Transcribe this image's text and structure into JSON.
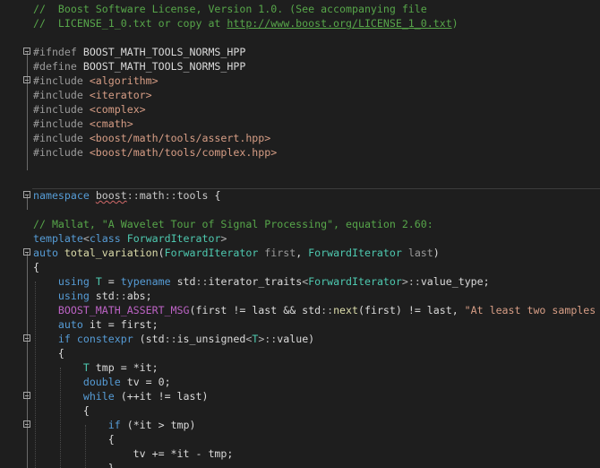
{
  "editor": {
    "lines": [
      [
        {
          "c": "comment",
          "t": "//  Boost Software License, Version 1.0. (See accompanying file"
        }
      ],
      [
        {
          "c": "comment",
          "t": "//  LICENSE_1_0.txt or copy at "
        },
        {
          "c": "link",
          "t": "http://www.boost.org/LICENSE_1_0.txt"
        },
        {
          "c": "comment",
          "t": ")"
        }
      ],
      [],
      [
        {
          "c": "pp",
          "t": "#ifndef "
        },
        {
          "c": "id",
          "t": "BOOST_MATH_TOOLS_NORMS_HPP"
        }
      ],
      [
        {
          "c": "pp",
          "t": "#define "
        },
        {
          "c": "id",
          "t": "BOOST_MATH_TOOLS_NORMS_HPP"
        }
      ],
      [
        {
          "c": "pp",
          "t": "#include "
        },
        {
          "c": "str",
          "t": "<algorithm>"
        }
      ],
      [
        {
          "c": "pp",
          "t": "#include "
        },
        {
          "c": "str",
          "t": "<iterator>"
        }
      ],
      [
        {
          "c": "pp",
          "t": "#include "
        },
        {
          "c": "str",
          "t": "<complex>"
        }
      ],
      [
        {
          "c": "pp",
          "t": "#include "
        },
        {
          "c": "str",
          "t": "<cmath>"
        }
      ],
      [
        {
          "c": "pp",
          "t": "#include "
        },
        {
          "c": "str",
          "t": "<boost/math/tools/assert.hpp>"
        }
      ],
      [
        {
          "c": "pp",
          "t": "#include "
        },
        {
          "c": "str",
          "t": "<boost/math/tools/complex.hpp>"
        }
      ],
      [],
      [],
      [
        {
          "c": "kw",
          "t": "namespace"
        },
        {
          "c": "id",
          "t": " "
        },
        {
          "c": "ns",
          "t": "boost",
          "sq": true
        },
        {
          "c": "op",
          "t": "::"
        },
        {
          "c": "ns",
          "t": "math"
        },
        {
          "c": "op",
          "t": "::"
        },
        {
          "c": "ns",
          "t": "tools"
        },
        {
          "c": "id",
          "t": " {"
        }
      ],
      [],
      [
        {
          "c": "comment",
          "t": "// Mallat, \"A Wavelet Tour of Signal Processing\", equation 2.60:"
        }
      ],
      [
        {
          "c": "kw",
          "t": "template"
        },
        {
          "c": "op",
          "t": "<"
        },
        {
          "c": "kw",
          "t": "class"
        },
        {
          "c": "id",
          "t": " "
        },
        {
          "c": "type",
          "t": "ForwardIterator"
        },
        {
          "c": "op",
          "t": ">"
        }
      ],
      [
        {
          "c": "kw",
          "t": "auto"
        },
        {
          "c": "id",
          "t": " "
        },
        {
          "c": "fn",
          "t": "total_variation"
        },
        {
          "c": "id",
          "t": "("
        },
        {
          "c": "type",
          "t": "ForwardIterator"
        },
        {
          "c": "id",
          "t": " "
        },
        {
          "c": "param",
          "t": "first"
        },
        {
          "c": "id",
          "t": ", "
        },
        {
          "c": "type",
          "t": "ForwardIterator"
        },
        {
          "c": "id",
          "t": " "
        },
        {
          "c": "param",
          "t": "last"
        },
        {
          "c": "id",
          "t": ")"
        }
      ],
      [
        {
          "c": "id",
          "t": "{"
        }
      ],
      [
        {
          "c": "id",
          "t": "    "
        },
        {
          "c": "kw",
          "t": "using"
        },
        {
          "c": "id",
          "t": " "
        },
        {
          "c": "type",
          "t": "T"
        },
        {
          "c": "id",
          "t": " = "
        },
        {
          "c": "kw",
          "t": "typename"
        },
        {
          "c": "id",
          "t": " std"
        },
        {
          "c": "op",
          "t": "::"
        },
        {
          "c": "id",
          "t": "iterator_traits"
        },
        {
          "c": "op",
          "t": "<"
        },
        {
          "c": "type",
          "t": "ForwardIterator"
        },
        {
          "c": "op",
          "t": ">::"
        },
        {
          "c": "id",
          "t": "value_type;"
        }
      ],
      [
        {
          "c": "id",
          "t": "    "
        },
        {
          "c": "kw",
          "t": "using"
        },
        {
          "c": "id",
          "t": " std"
        },
        {
          "c": "op",
          "t": "::"
        },
        {
          "c": "id",
          "t": "abs;"
        }
      ],
      [
        {
          "c": "id",
          "t": "    "
        },
        {
          "c": "mac",
          "t": "BOOST_MATH_ASSERT_MSG"
        },
        {
          "c": "id",
          "t": "(first != last && std"
        },
        {
          "c": "op",
          "t": "::"
        },
        {
          "c": "fn",
          "t": "next"
        },
        {
          "c": "id",
          "t": "(first) != last, "
        },
        {
          "c": "str",
          "t": "\"At least two samples"
        }
      ],
      [
        {
          "c": "id",
          "t": "    "
        },
        {
          "c": "kw",
          "t": "auto"
        },
        {
          "c": "id",
          "t": " it = first;"
        }
      ],
      [
        {
          "c": "id",
          "t": "    "
        },
        {
          "c": "kw",
          "t": "if"
        },
        {
          "c": "id",
          "t": " "
        },
        {
          "c": "kw",
          "t": "constexpr"
        },
        {
          "c": "id",
          "t": " (std"
        },
        {
          "c": "op",
          "t": "::"
        },
        {
          "c": "id",
          "t": "is_unsigned"
        },
        {
          "c": "op",
          "t": "<"
        },
        {
          "c": "type",
          "t": "T"
        },
        {
          "c": "op",
          "t": ">::"
        },
        {
          "c": "id",
          "t": "value)"
        }
      ],
      [
        {
          "c": "id",
          "t": "    {"
        }
      ],
      [
        {
          "c": "id",
          "t": "        "
        },
        {
          "c": "type",
          "t": "T"
        },
        {
          "c": "id",
          "t": " tmp = *it;"
        }
      ],
      [
        {
          "c": "id",
          "t": "        "
        },
        {
          "c": "kw",
          "t": "double"
        },
        {
          "c": "id",
          "t": " tv = 0;"
        }
      ],
      [
        {
          "c": "id",
          "t": "        "
        },
        {
          "c": "kw",
          "t": "while"
        },
        {
          "c": "id",
          "t": " (++it != last)"
        }
      ],
      [
        {
          "c": "id",
          "t": "        {"
        }
      ],
      [
        {
          "c": "id",
          "t": "            "
        },
        {
          "c": "kw",
          "t": "if"
        },
        {
          "c": "id",
          "t": " (*it > tmp)"
        }
      ],
      [
        {
          "c": "id",
          "t": "            {"
        }
      ],
      [
        {
          "c": "id",
          "t": "                tv += *it - tmp;"
        }
      ],
      [
        {
          "c": "id",
          "t": "            }"
        }
      ]
    ]
  }
}
